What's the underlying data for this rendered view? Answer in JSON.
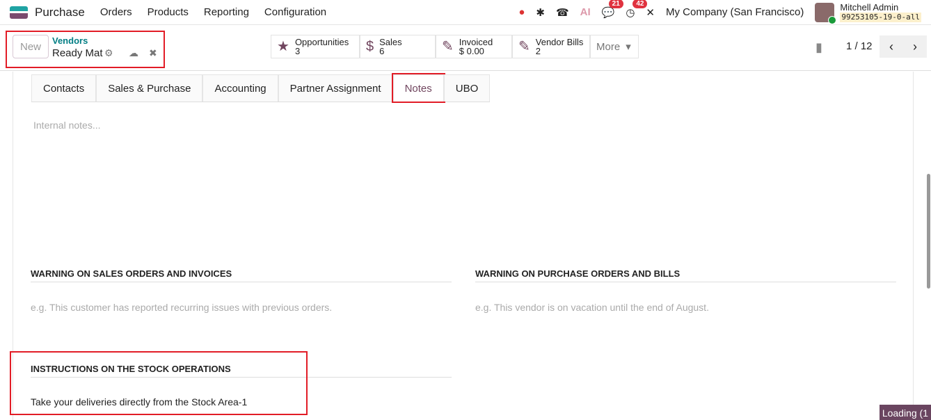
{
  "nav": {
    "app": "Purchase",
    "menus": [
      "Orders",
      "Products",
      "Reporting",
      "Configuration"
    ],
    "chat_count": "21",
    "activity_count": "42",
    "company": "My Company (San Francisco)",
    "user": "Mitchell Admin",
    "db": "99253105-19-0-all"
  },
  "control": {
    "new": "New",
    "breadcrumb": "Vendors",
    "record": "Ready Mat",
    "pager": "1 / 12",
    "more": "More"
  },
  "stats": [
    {
      "label": "Opportunities",
      "value": "3",
      "icon": "★"
    },
    {
      "label": "Sales",
      "value": "6",
      "icon": "$"
    },
    {
      "label": "Invoiced",
      "value": "$ 0.00",
      "icon": "✎"
    },
    {
      "label": "Vendor Bills",
      "value": "2",
      "icon": "✎"
    }
  ],
  "tabs": [
    "Contacts",
    "Sales & Purchase",
    "Accounting",
    "Partner Assignment",
    "Notes",
    "UBO"
  ],
  "notes": {
    "internal_placeholder": "Internal notes...",
    "warn_sales_title": "WARNING ON SALES ORDERS AND INVOICES",
    "warn_sales_placeholder": "e.g. This customer has reported recurring issues with previous orders.",
    "warn_purchase_title": "WARNING ON PURCHASE ORDERS AND BILLS",
    "warn_purchase_placeholder": "e.g. This vendor is on vacation until the end of August.",
    "stock_title": "INSTRUCTIONS ON THE STOCK OPERATIONS",
    "stock_value": "Take your deliveries directly from the Stock Area-1"
  },
  "loading": "Loading (1"
}
